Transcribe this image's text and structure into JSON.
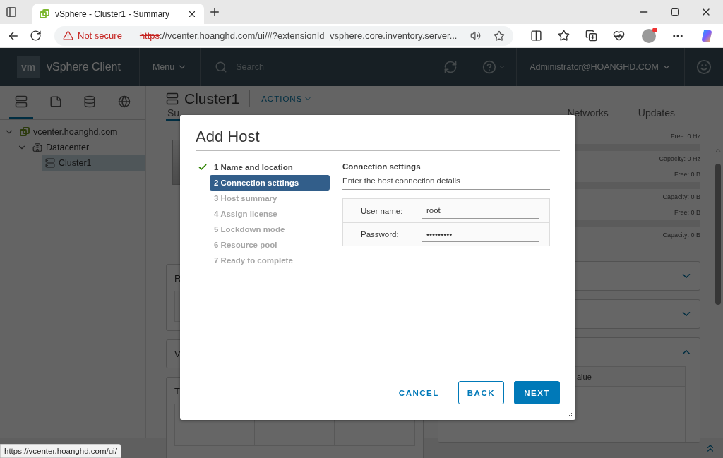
{
  "browser": {
    "tab": {
      "title": "vSphere - Cluster1 - Summary"
    },
    "address": {
      "security": "Not secure",
      "scheme": "https",
      "rest": "://vcenter.hoanghd.com/ui/#?extensionId=vsphere.core.inventory.server..."
    },
    "status_url": "https://vcenter.hoanghd.com/ui/"
  },
  "app": {
    "logo": "vm",
    "product": "vSphere Client",
    "menu": "Menu",
    "search": {
      "placeholder": "Search"
    },
    "user": "Administrator@HOANGHD.COM"
  },
  "navigator": {
    "tabs": [
      {
        "kind": "hosts",
        "selected": true
      },
      {
        "kind": "vms",
        "selected": false
      },
      {
        "kind": "storage",
        "selected": false
      },
      {
        "kind": "network",
        "selected": false
      }
    ],
    "tree": [
      {
        "label": "vcenter.hoanghd.com",
        "kind": "vcenter",
        "expanded": true,
        "selected": false,
        "children": [
          {
            "label": "Datacenter",
            "kind": "datacenter",
            "expanded": true,
            "selected": false,
            "children": [
              {
                "label": "Cluster1",
                "kind": "cluster",
                "selected": true
              }
            ]
          }
        ]
      }
    ]
  },
  "object": {
    "title": "Cluster1",
    "actions": "ACTIONS",
    "tabs": [
      {
        "label": "Su",
        "selected": true
      },
      {
        "label": "Networks",
        "selected": false
      },
      {
        "label": "Updates",
        "selected": false
      }
    ]
  },
  "summary": {
    "left_cards": [
      {
        "title": "R",
        "kind": "box"
      },
      {
        "title": "V",
        "kind": "plain"
      },
      {
        "title": "T",
        "kind": "table"
      }
    ],
    "resources": [
      {
        "free": "Free: 0 Hz",
        "capacity": "Capacity: 0 Hz"
      },
      {
        "free": "Free: 0 B",
        "capacity": "Capacity: 0 B"
      },
      {
        "free": "Free: 0 B",
        "capacity": "Capacity: 0 B"
      }
    ],
    "right_cards": [
      {
        "expanded": false
      },
      {
        "expanded": false
      },
      {
        "expanded": true,
        "column": "alue"
      }
    ]
  },
  "dialog": {
    "title": "Add Host",
    "steps": [
      {
        "label": "1 Name and location",
        "done": true,
        "selected": false
      },
      {
        "label": "2 Connection settings",
        "done": false,
        "selected": true
      },
      {
        "label": "3 Host summary",
        "done": false,
        "selected": false
      },
      {
        "label": "4 Assign license",
        "done": false,
        "selected": false
      },
      {
        "label": "5 Lockdown mode",
        "done": false,
        "selected": false
      },
      {
        "label": "6 Resource pool",
        "done": false,
        "selected": false
      },
      {
        "label": "7 Ready to complete",
        "done": false,
        "selected": false
      }
    ],
    "section": {
      "title": "Connection settings",
      "subtitle": "Enter the host connection details"
    },
    "fields": [
      {
        "label": "User name:",
        "value": "root"
      },
      {
        "label": "Password:",
        "value": "•••••••••"
      }
    ],
    "buttons": [
      {
        "label": "CANCEL",
        "kind": "flat"
      },
      {
        "label": "BACK",
        "kind": "outline"
      },
      {
        "label": "NEXT",
        "kind": "primary"
      }
    ]
  }
}
